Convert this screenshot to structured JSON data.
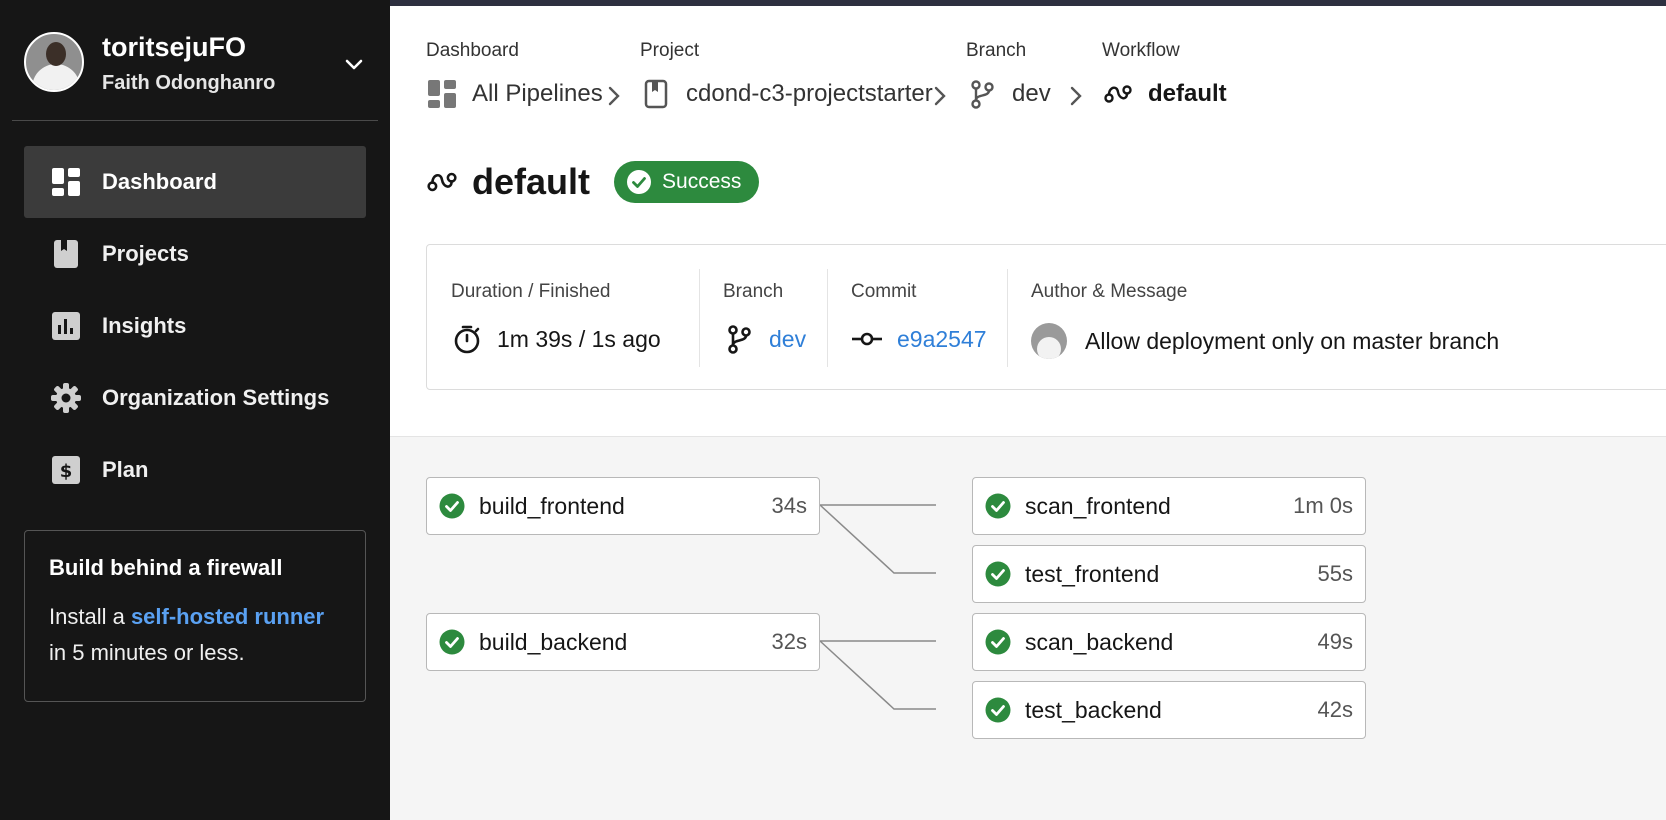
{
  "user": {
    "username": "toritsejuFO",
    "full_name": "Faith Odonghanro"
  },
  "sidebar": {
    "items": [
      {
        "label": "Dashboard",
        "icon": "dashboard-icon",
        "active": true
      },
      {
        "label": "Projects",
        "icon": "book-icon",
        "active": false
      },
      {
        "label": "Insights",
        "icon": "chart-icon",
        "active": false
      },
      {
        "label": "Organization Settings",
        "icon": "gear-icon",
        "active": false
      },
      {
        "label": "Plan",
        "icon": "dollar-icon",
        "active": false
      }
    ],
    "promo": {
      "title": "Build behind a firewall",
      "text_before": "Install a ",
      "link": "self-hosted runner",
      "text_after": "in 5 minutes or less."
    }
  },
  "breadcrumbs": [
    {
      "label": "Dashboard",
      "value": "All Pipelines",
      "icon": "dashboard-icon"
    },
    {
      "label": "Project",
      "value": "cdond-c3-projectstarter",
      "icon": "book-icon"
    },
    {
      "label": "Branch",
      "value": "dev",
      "icon": "branch-icon"
    },
    {
      "label": "Workflow",
      "value": "default",
      "icon": "workflow-icon"
    }
  ],
  "workflow": {
    "title": "default",
    "status": "Success"
  },
  "info": {
    "duration_label": "Duration / Finished",
    "duration_value": "1m 39s / 1s ago",
    "branch_label": "Branch",
    "branch_value": "dev",
    "commit_label": "Commit",
    "commit_value": "e9a2547",
    "author_label": "Author & Message",
    "message": "Allow deployment only on master branch"
  },
  "jobs": [
    {
      "name": "build_frontend",
      "duration": "34s",
      "status": "success"
    },
    {
      "name": "scan_frontend",
      "duration": "1m 0s",
      "status": "success"
    },
    {
      "name": "test_frontend",
      "duration": "55s",
      "status": "success"
    },
    {
      "name": "build_backend",
      "duration": "32s",
      "status": "success"
    },
    {
      "name": "scan_backend",
      "duration": "49s",
      "status": "success"
    },
    {
      "name": "test_backend",
      "duration": "42s",
      "status": "success"
    }
  ],
  "colors": {
    "success": "#2d8a3e",
    "link": "#2f7fd8",
    "sidebar_bg": "#161616",
    "canvas_bg": "#f5f5f5"
  }
}
